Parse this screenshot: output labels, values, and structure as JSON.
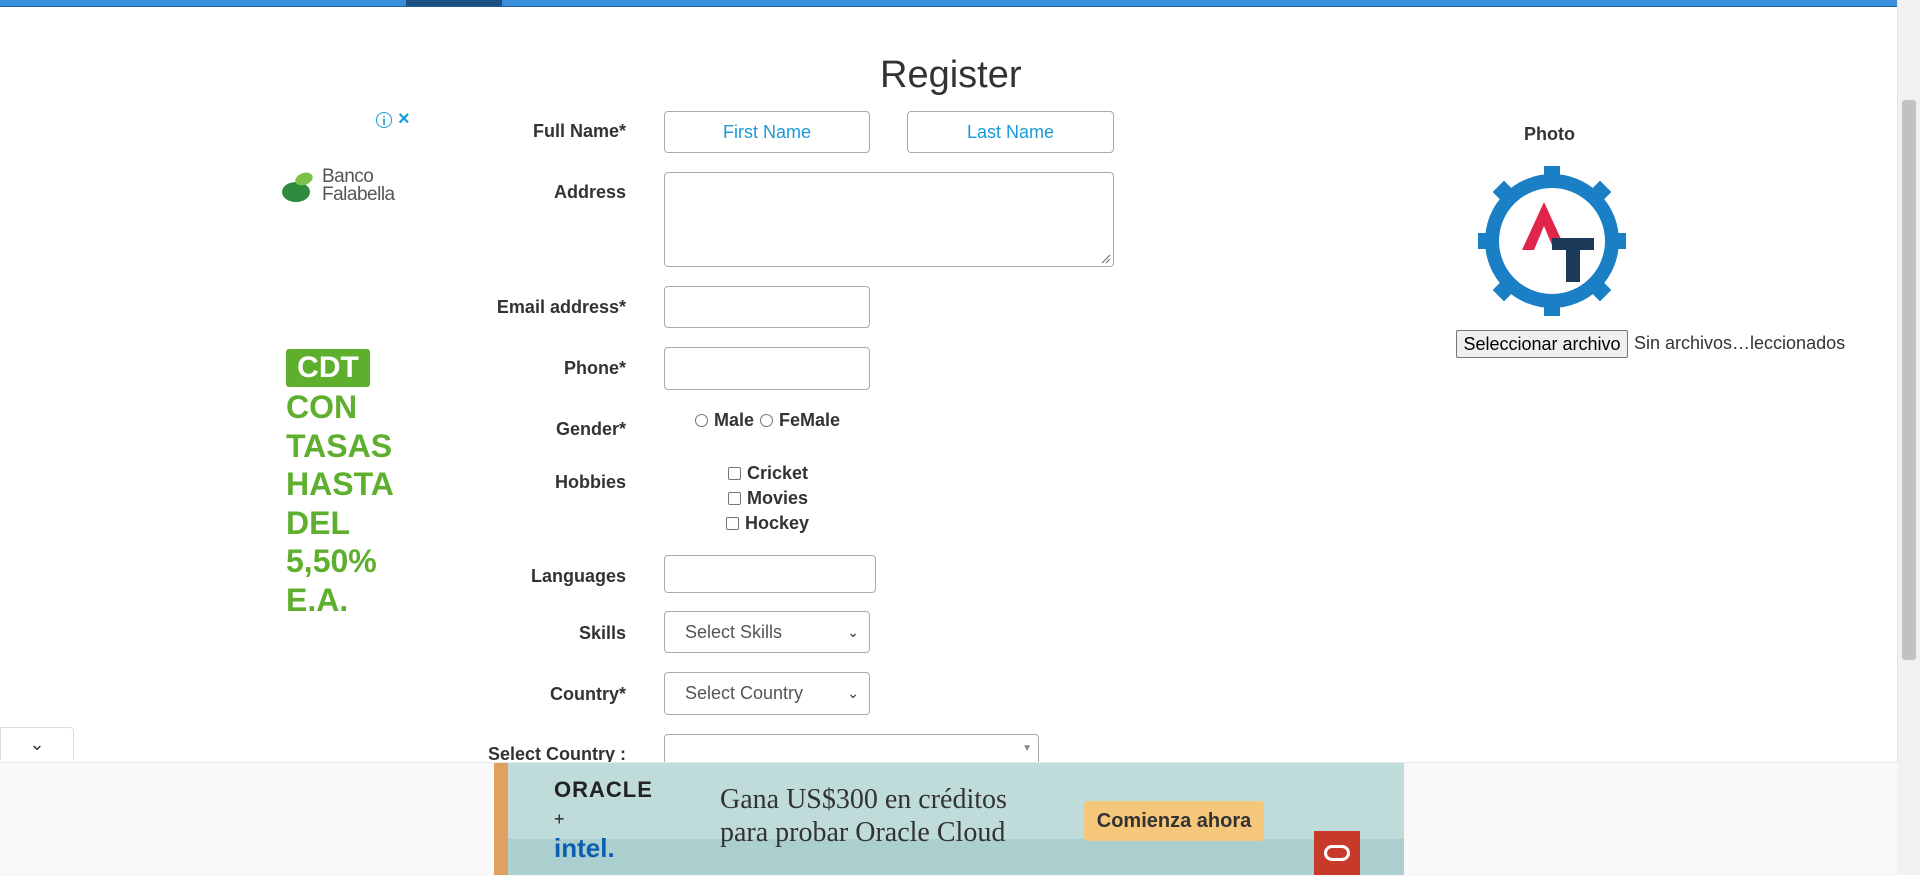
{
  "page_title": "Register",
  "form": {
    "full_name_label": "Full Name*",
    "first_name_placeholder": "First Name",
    "last_name_placeholder": "Last Name",
    "address_label": "Address",
    "email_label": "Email address*",
    "phone_label": "Phone*",
    "gender_label": "Gender*",
    "gender_options": [
      "Male",
      "FeMale"
    ],
    "hobbies_label": "Hobbies",
    "hobbies": [
      "Cricket",
      "Movies",
      "Hockey"
    ],
    "languages_label": "Languages",
    "skills_label": "Skills",
    "skills_select": "Select Skills",
    "country_label": "Country*",
    "country_select": "Select Country",
    "select_country_label": "Select Country :"
  },
  "photo": {
    "label": "Photo",
    "file_button": "Seleccionar archivo",
    "file_status": "Sin archivos…leccionados"
  },
  "left_ad": {
    "brand_line1": "Banco",
    "brand_line2": "Falabella",
    "badge": "CDT",
    "lines": [
      "CON",
      "TASAS",
      "HASTA",
      "DEL",
      "5,50%",
      "E.A."
    ],
    "info_icon": "info-icon",
    "close_icon": "close-icon"
  },
  "bottom_ad": {
    "brand": "ORACLE",
    "plus": "+",
    "partner": "intel.",
    "message_line1": "Gana US$300 en créditos",
    "message_line2": "para probar Oracle Cloud",
    "cta": "Comienza ahora"
  },
  "colors": {
    "nav_blue": "#3a8fdc",
    "placeholder_blue": "#1a9ad8",
    "ad_green": "#5faf2e",
    "logo_blue": "#1a7fc4",
    "logo_red": "#e0244a",
    "logo_navy": "#1e3a5a"
  }
}
